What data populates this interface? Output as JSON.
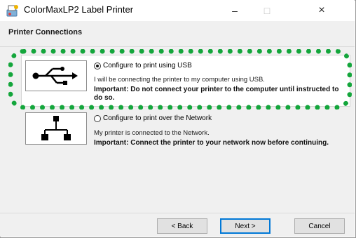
{
  "window": {
    "title": "ColorMaxLP2 Label Printer",
    "controls": {
      "minimize": "–",
      "maximize": "□",
      "close": "×"
    }
  },
  "header": {
    "title": "Printer Connections"
  },
  "options": [
    {
      "label": "Configure to print using USB",
      "selected": true,
      "description": "I will be connecting the printer to my computer using USB.",
      "important": "Important: Do not connect your printer to the computer until instructed to do so.",
      "icon": "usb-icon"
    },
    {
      "label": "Configure to print over the Network",
      "selected": false,
      "description": "My printer is connected to the Network.",
      "important": "Important: Connect the printer to your network now before continuing.",
      "icon": "network-icon"
    }
  ],
  "buttons": {
    "back": "< Back",
    "next": "Next >",
    "cancel": "Cancel"
  },
  "colors": {
    "highlight": "#14a63c",
    "accent": "#0078d7"
  }
}
